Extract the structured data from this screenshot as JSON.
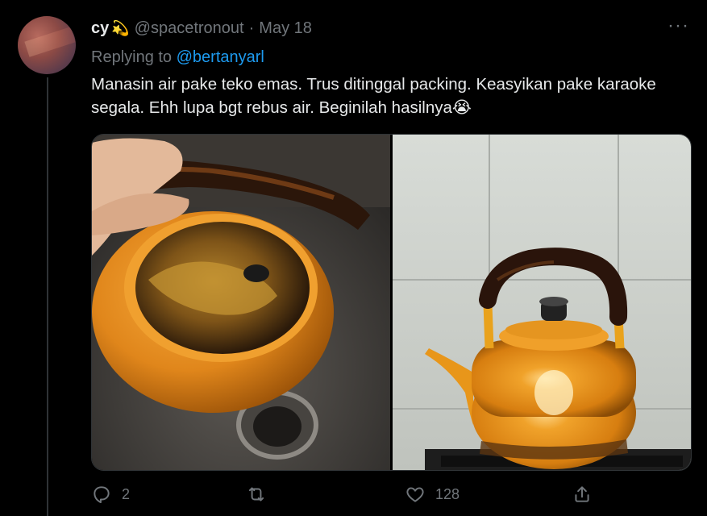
{
  "tweet": {
    "author_name": "cy",
    "name_emoji": "💫",
    "handle": "@spacetronout",
    "separator": "·",
    "date": "May 18",
    "more_label": "···",
    "replying_to_label": "Replying to",
    "replying_to_handle": "@bertanyarl",
    "text": "Manasin air pake teko emas. Trus ditinggal packing. Keasyikan pake karaoke segala. Ehh lupa bgt rebus air. Beginilah hasilnya😭"
  },
  "actions": {
    "reply_count": "2",
    "retweet_count": "",
    "like_count": "128"
  },
  "colors": {
    "background": "#000000",
    "text": "#e7e9ea",
    "muted": "#71767b",
    "link": "#1d9bf0",
    "kettle_orange": "#e8961a"
  }
}
